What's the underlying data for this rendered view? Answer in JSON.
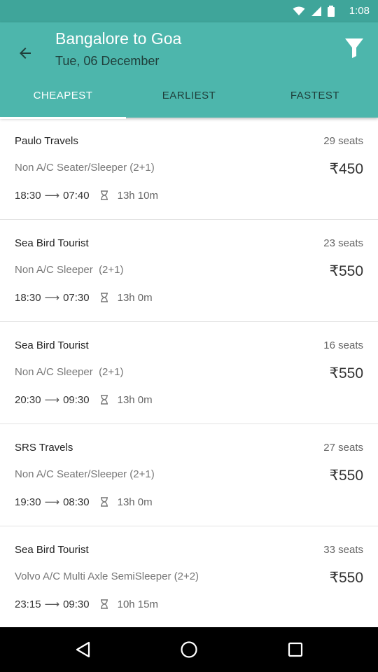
{
  "status_bar": {
    "time": "1:08"
  },
  "header": {
    "title": "Bangalore to Goa",
    "subtitle": "Tue, 06 December",
    "back_icon": "arrow-back-icon",
    "filter_icon": "filter-funnel-icon",
    "background_color": "#4db6ac"
  },
  "tabs": [
    {
      "label": "CHEAPEST",
      "active": true
    },
    {
      "label": "EARLIEST",
      "active": false
    },
    {
      "label": "FASTEST",
      "active": false
    }
  ],
  "buses": [
    {
      "operator": "Paulo Travels",
      "seats": "29 seats",
      "type": "Non A/C Seater/Sleeper (2+1)",
      "price": "₹450",
      "depart": "18:30",
      "arrive": "07:40",
      "duration": "13h 10m"
    },
    {
      "operator": "Sea Bird Tourist",
      "seats": "23 seats",
      "type": "Non A/C Sleeper  (2+1)",
      "price": "₹550",
      "depart": "18:30",
      "arrive": "07:30",
      "duration": "13h 0m"
    },
    {
      "operator": "Sea Bird Tourist",
      "seats": "16 seats",
      "type": "Non A/C Sleeper  (2+1)",
      "price": "₹550",
      "depart": "20:30",
      "arrive": "09:30",
      "duration": "13h 0m"
    },
    {
      "operator": "SRS Travels",
      "seats": "27 seats",
      "type": "Non A/C Seater/Sleeper (2+1)",
      "price": "₹550",
      "depart": "19:30",
      "arrive": "08:30",
      "duration": "13h 0m"
    },
    {
      "operator": "Sea Bird Tourist",
      "seats": "33 seats",
      "type": "Volvo A/C Multi Axle SemiSleeper (2+2)",
      "price": "₹550",
      "depart": "23:15",
      "arrive": "09:30",
      "duration": "10h 15m"
    }
  ],
  "nav_bar": {
    "icons": [
      "back-triangle-icon",
      "home-circle-icon",
      "recents-square-icon"
    ]
  }
}
